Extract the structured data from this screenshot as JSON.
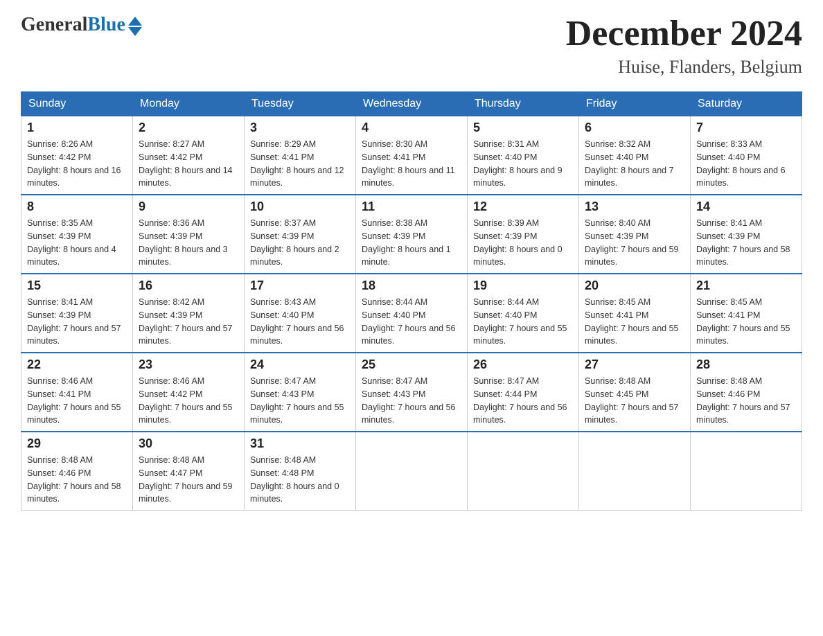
{
  "header": {
    "logo": {
      "general": "General",
      "blue": "Blue",
      "triangle": "▲"
    },
    "title": "December 2024",
    "location": "Huise, Flanders, Belgium"
  },
  "weekdays": [
    "Sunday",
    "Monday",
    "Tuesday",
    "Wednesday",
    "Thursday",
    "Friday",
    "Saturday"
  ],
  "weeks": [
    [
      {
        "day": "1",
        "sunrise": "8:26 AM",
        "sunset": "4:42 PM",
        "daylight": "8 hours and 16 minutes."
      },
      {
        "day": "2",
        "sunrise": "8:27 AM",
        "sunset": "4:42 PM",
        "daylight": "8 hours and 14 minutes."
      },
      {
        "day": "3",
        "sunrise": "8:29 AM",
        "sunset": "4:41 PM",
        "daylight": "8 hours and 12 minutes."
      },
      {
        "day": "4",
        "sunrise": "8:30 AM",
        "sunset": "4:41 PM",
        "daylight": "8 hours and 11 minutes."
      },
      {
        "day": "5",
        "sunrise": "8:31 AM",
        "sunset": "4:40 PM",
        "daylight": "8 hours and 9 minutes."
      },
      {
        "day": "6",
        "sunrise": "8:32 AM",
        "sunset": "4:40 PM",
        "daylight": "8 hours and 7 minutes."
      },
      {
        "day": "7",
        "sunrise": "8:33 AM",
        "sunset": "4:40 PM",
        "daylight": "8 hours and 6 minutes."
      }
    ],
    [
      {
        "day": "8",
        "sunrise": "8:35 AM",
        "sunset": "4:39 PM",
        "daylight": "8 hours and 4 minutes."
      },
      {
        "day": "9",
        "sunrise": "8:36 AM",
        "sunset": "4:39 PM",
        "daylight": "8 hours and 3 minutes."
      },
      {
        "day": "10",
        "sunrise": "8:37 AM",
        "sunset": "4:39 PM",
        "daylight": "8 hours and 2 minutes."
      },
      {
        "day": "11",
        "sunrise": "8:38 AM",
        "sunset": "4:39 PM",
        "daylight": "8 hours and 1 minute."
      },
      {
        "day": "12",
        "sunrise": "8:39 AM",
        "sunset": "4:39 PM",
        "daylight": "8 hours and 0 minutes."
      },
      {
        "day": "13",
        "sunrise": "8:40 AM",
        "sunset": "4:39 PM",
        "daylight": "7 hours and 59 minutes."
      },
      {
        "day": "14",
        "sunrise": "8:41 AM",
        "sunset": "4:39 PM",
        "daylight": "7 hours and 58 minutes."
      }
    ],
    [
      {
        "day": "15",
        "sunrise": "8:41 AM",
        "sunset": "4:39 PM",
        "daylight": "7 hours and 57 minutes."
      },
      {
        "day": "16",
        "sunrise": "8:42 AM",
        "sunset": "4:39 PM",
        "daylight": "7 hours and 57 minutes."
      },
      {
        "day": "17",
        "sunrise": "8:43 AM",
        "sunset": "4:40 PM",
        "daylight": "7 hours and 56 minutes."
      },
      {
        "day": "18",
        "sunrise": "8:44 AM",
        "sunset": "4:40 PM",
        "daylight": "7 hours and 56 minutes."
      },
      {
        "day": "19",
        "sunrise": "8:44 AM",
        "sunset": "4:40 PM",
        "daylight": "7 hours and 55 minutes."
      },
      {
        "day": "20",
        "sunrise": "8:45 AM",
        "sunset": "4:41 PM",
        "daylight": "7 hours and 55 minutes."
      },
      {
        "day": "21",
        "sunrise": "8:45 AM",
        "sunset": "4:41 PM",
        "daylight": "7 hours and 55 minutes."
      }
    ],
    [
      {
        "day": "22",
        "sunrise": "8:46 AM",
        "sunset": "4:41 PM",
        "daylight": "7 hours and 55 minutes."
      },
      {
        "day": "23",
        "sunrise": "8:46 AM",
        "sunset": "4:42 PM",
        "daylight": "7 hours and 55 minutes."
      },
      {
        "day": "24",
        "sunrise": "8:47 AM",
        "sunset": "4:43 PM",
        "daylight": "7 hours and 55 minutes."
      },
      {
        "day": "25",
        "sunrise": "8:47 AM",
        "sunset": "4:43 PM",
        "daylight": "7 hours and 56 minutes."
      },
      {
        "day": "26",
        "sunrise": "8:47 AM",
        "sunset": "4:44 PM",
        "daylight": "7 hours and 56 minutes."
      },
      {
        "day": "27",
        "sunrise": "8:48 AM",
        "sunset": "4:45 PM",
        "daylight": "7 hours and 57 minutes."
      },
      {
        "day": "28",
        "sunrise": "8:48 AM",
        "sunset": "4:46 PM",
        "daylight": "7 hours and 57 minutes."
      }
    ],
    [
      {
        "day": "29",
        "sunrise": "8:48 AM",
        "sunset": "4:46 PM",
        "daylight": "7 hours and 58 minutes."
      },
      {
        "day": "30",
        "sunrise": "8:48 AM",
        "sunset": "4:47 PM",
        "daylight": "7 hours and 59 minutes."
      },
      {
        "day": "31",
        "sunrise": "8:48 AM",
        "sunset": "4:48 PM",
        "daylight": "8 hours and 0 minutes."
      },
      null,
      null,
      null,
      null
    ]
  ],
  "labels": {
    "sunrise": "Sunrise:",
    "sunset": "Sunset:",
    "daylight": "Daylight:"
  }
}
